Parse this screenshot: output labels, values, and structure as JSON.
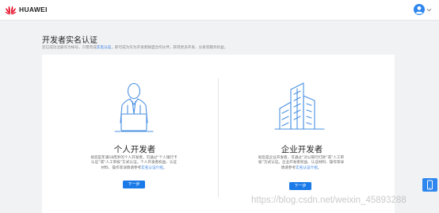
{
  "header": {
    "brand": "HUAWEI",
    "colors": {
      "brand_red": "#e3001b",
      "accent_blue": "#1a7ae8"
    }
  },
  "page": {
    "title": "开发者实名认证",
    "subtitle_before": "您已成功注册华为帐号。只需完成",
    "subtitle_link": "实名认证",
    "subtitle_after": "，即可成为华为开发者联盟合作伙伴，获得更多开发、分发等服务权益。"
  },
  "cards": {
    "personal": {
      "icon": "person-with-laptop-icon",
      "title": "个人开发者",
      "desc_line1": "如您是年满18周岁的个人开发者，可通过“个人银行卡",
      "desc_line2": "认证”或“人工审核”方式认证。个人开发者权益、认证",
      "desc_line3_before": "材料、操作等详情请参考",
      "desc_link": "实名认证介绍",
      "desc_line3_after": "。",
      "button": "下一步"
    },
    "enterprise": {
      "icon": "office-buildings-icon",
      "title": "企业开发者",
      "desc_line1": "如您是企业开发者，可通过“对公银行打款”或“人工审",
      "desc_line2": "核”方式认证。企业开发者权益、认证材料、操作等详",
      "desc_line3_before": "情请参考",
      "desc_link": "实名认证介绍",
      "desc_line3_after": "。",
      "button": "下一步"
    }
  },
  "watermark": "https://blog.csdn.net/weixin_45893288"
}
